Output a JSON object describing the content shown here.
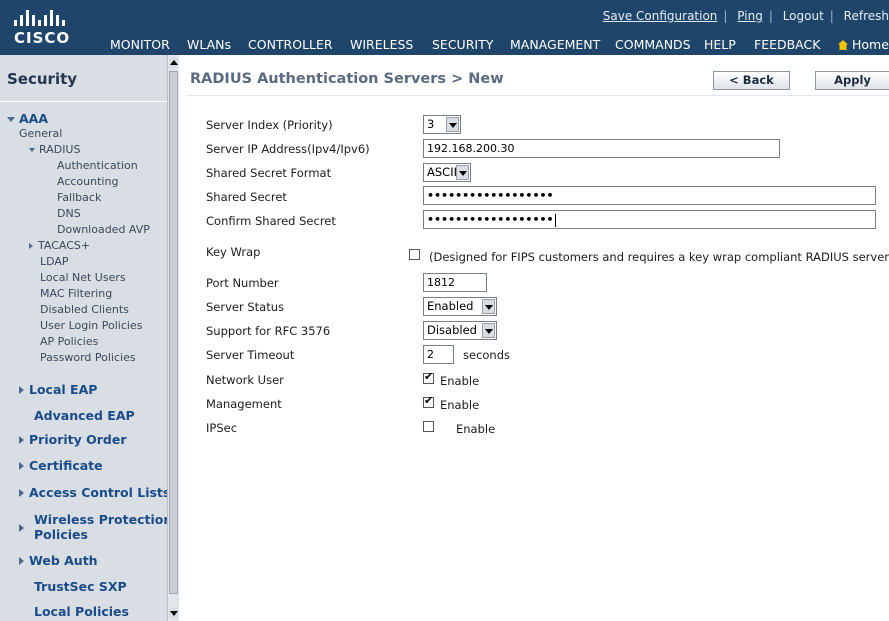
{
  "header": {
    "brand": "CISCO",
    "utility_links": [
      "Save Configuration",
      "Ping",
      "Logout",
      "Refresh"
    ],
    "nav": [
      "MONITOR",
      "WLANs",
      "CONTROLLER",
      "WIRELESS",
      "SECURITY",
      "MANAGEMENT",
      "COMMANDS",
      "HELP",
      "FEEDBACK",
      "Home"
    ],
    "active_nav": "SECURITY"
  },
  "sidebar": {
    "title": "Security",
    "aaa": "AAA",
    "general": "General",
    "radius": "RADIUS",
    "radius_items": [
      "Authentication",
      "Accounting",
      "Fallback",
      "DNS",
      "Downloaded AVP"
    ],
    "tacacs": "TACACS+",
    "aaa_items": [
      "LDAP",
      "Local Net Users",
      "MAC Filtering",
      "Disabled Clients",
      "User Login Policies",
      "AP Policies",
      "Password Policies"
    ],
    "sections": [
      "Local EAP",
      "Advanced EAP",
      "Priority Order",
      "Certificate",
      "Access Control Lists",
      "Wireless Protection",
      "Policies",
      "Web Auth",
      "TrustSec SXP",
      "Local Policies"
    ]
  },
  "page": {
    "title": "RADIUS Authentication Servers > New",
    "back_label": "< Back",
    "apply_label": "Apply"
  },
  "form": {
    "server_index_label": "Server Index (Priority)",
    "server_index_value": "3",
    "server_ip_label": "Server IP Address(Ipv4/Ipv6)",
    "server_ip_value": "192.168.200.30",
    "secret_format_label": "Shared Secret Format",
    "secret_format_value": "ASCII",
    "secret_label": "Shared Secret",
    "secret_value": "••••••••••••••••••",
    "confirm_label": "Confirm Shared Secret",
    "confirm_value": "••••••••••••••••••",
    "key_wrap_label": "Key Wrap",
    "key_wrap_note": "(Designed for FIPS customers and requires a key wrap compliant RADIUS server)",
    "port_label": "Port Number",
    "port_value": "1812",
    "status_label": "Server Status",
    "status_value": "Enabled",
    "rfc_label": "Support for RFC 3576",
    "rfc_value": "Disabled",
    "timeout_label": "Server Timeout",
    "timeout_value": "2",
    "timeout_unit": "seconds",
    "network_user_label": "Network User",
    "network_user_enable": "Enable",
    "management_label": "Management",
    "management_enable": "Enable",
    "ipsec_label": "IPSec",
    "ipsec_enable": "Enable"
  }
}
